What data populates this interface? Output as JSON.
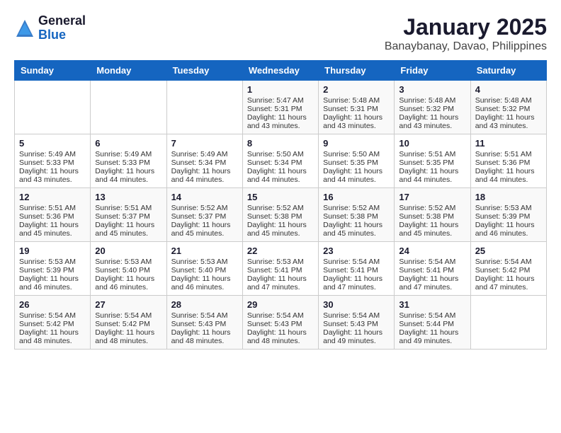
{
  "header": {
    "logo_general": "General",
    "logo_blue": "Blue",
    "title": "January 2025",
    "subtitle": "Banaybanay, Davao, Philippines"
  },
  "days_of_week": [
    "Sunday",
    "Monday",
    "Tuesday",
    "Wednesday",
    "Thursday",
    "Friday",
    "Saturday"
  ],
  "weeks": [
    [
      {
        "day": "",
        "content": ""
      },
      {
        "day": "",
        "content": ""
      },
      {
        "day": "",
        "content": ""
      },
      {
        "day": "1",
        "content": "Sunrise: 5:47 AM\nSunset: 5:31 PM\nDaylight: 11 hours\nand 43 minutes."
      },
      {
        "day": "2",
        "content": "Sunrise: 5:48 AM\nSunset: 5:31 PM\nDaylight: 11 hours\nand 43 minutes."
      },
      {
        "day": "3",
        "content": "Sunrise: 5:48 AM\nSunset: 5:32 PM\nDaylight: 11 hours\nand 43 minutes."
      },
      {
        "day": "4",
        "content": "Sunrise: 5:48 AM\nSunset: 5:32 PM\nDaylight: 11 hours\nand 43 minutes."
      }
    ],
    [
      {
        "day": "5",
        "content": "Sunrise: 5:49 AM\nSunset: 5:33 PM\nDaylight: 11 hours\nand 43 minutes."
      },
      {
        "day": "6",
        "content": "Sunrise: 5:49 AM\nSunset: 5:33 PM\nDaylight: 11 hours\nand 44 minutes."
      },
      {
        "day": "7",
        "content": "Sunrise: 5:49 AM\nSunset: 5:34 PM\nDaylight: 11 hours\nand 44 minutes."
      },
      {
        "day": "8",
        "content": "Sunrise: 5:50 AM\nSunset: 5:34 PM\nDaylight: 11 hours\nand 44 minutes."
      },
      {
        "day": "9",
        "content": "Sunrise: 5:50 AM\nSunset: 5:35 PM\nDaylight: 11 hours\nand 44 minutes."
      },
      {
        "day": "10",
        "content": "Sunrise: 5:51 AM\nSunset: 5:35 PM\nDaylight: 11 hours\nand 44 minutes."
      },
      {
        "day": "11",
        "content": "Sunrise: 5:51 AM\nSunset: 5:36 PM\nDaylight: 11 hours\nand 44 minutes."
      }
    ],
    [
      {
        "day": "12",
        "content": "Sunrise: 5:51 AM\nSunset: 5:36 PM\nDaylight: 11 hours\nand 45 minutes."
      },
      {
        "day": "13",
        "content": "Sunrise: 5:51 AM\nSunset: 5:37 PM\nDaylight: 11 hours\nand 45 minutes."
      },
      {
        "day": "14",
        "content": "Sunrise: 5:52 AM\nSunset: 5:37 PM\nDaylight: 11 hours\nand 45 minutes."
      },
      {
        "day": "15",
        "content": "Sunrise: 5:52 AM\nSunset: 5:38 PM\nDaylight: 11 hours\nand 45 minutes."
      },
      {
        "day": "16",
        "content": "Sunrise: 5:52 AM\nSunset: 5:38 PM\nDaylight: 11 hours\nand 45 minutes."
      },
      {
        "day": "17",
        "content": "Sunrise: 5:52 AM\nSunset: 5:38 PM\nDaylight: 11 hours\nand 45 minutes."
      },
      {
        "day": "18",
        "content": "Sunrise: 5:53 AM\nSunset: 5:39 PM\nDaylight: 11 hours\nand 46 minutes."
      }
    ],
    [
      {
        "day": "19",
        "content": "Sunrise: 5:53 AM\nSunset: 5:39 PM\nDaylight: 11 hours\nand 46 minutes."
      },
      {
        "day": "20",
        "content": "Sunrise: 5:53 AM\nSunset: 5:40 PM\nDaylight: 11 hours\nand 46 minutes."
      },
      {
        "day": "21",
        "content": "Sunrise: 5:53 AM\nSunset: 5:40 PM\nDaylight: 11 hours\nand 46 minutes."
      },
      {
        "day": "22",
        "content": "Sunrise: 5:53 AM\nSunset: 5:41 PM\nDaylight: 11 hours\nand 47 minutes."
      },
      {
        "day": "23",
        "content": "Sunrise: 5:54 AM\nSunset: 5:41 PM\nDaylight: 11 hours\nand 47 minutes."
      },
      {
        "day": "24",
        "content": "Sunrise: 5:54 AM\nSunset: 5:41 PM\nDaylight: 11 hours\nand 47 minutes."
      },
      {
        "day": "25",
        "content": "Sunrise: 5:54 AM\nSunset: 5:42 PM\nDaylight: 11 hours\nand 47 minutes."
      }
    ],
    [
      {
        "day": "26",
        "content": "Sunrise: 5:54 AM\nSunset: 5:42 PM\nDaylight: 11 hours\nand 48 minutes."
      },
      {
        "day": "27",
        "content": "Sunrise: 5:54 AM\nSunset: 5:42 PM\nDaylight: 11 hours\nand 48 minutes."
      },
      {
        "day": "28",
        "content": "Sunrise: 5:54 AM\nSunset: 5:43 PM\nDaylight: 11 hours\nand 48 minutes."
      },
      {
        "day": "29",
        "content": "Sunrise: 5:54 AM\nSunset: 5:43 PM\nDaylight: 11 hours\nand 48 minutes."
      },
      {
        "day": "30",
        "content": "Sunrise: 5:54 AM\nSunset: 5:43 PM\nDaylight: 11 hours\nand 49 minutes."
      },
      {
        "day": "31",
        "content": "Sunrise: 5:54 AM\nSunset: 5:44 PM\nDaylight: 11 hours\nand 49 minutes."
      },
      {
        "day": "",
        "content": ""
      }
    ]
  ]
}
